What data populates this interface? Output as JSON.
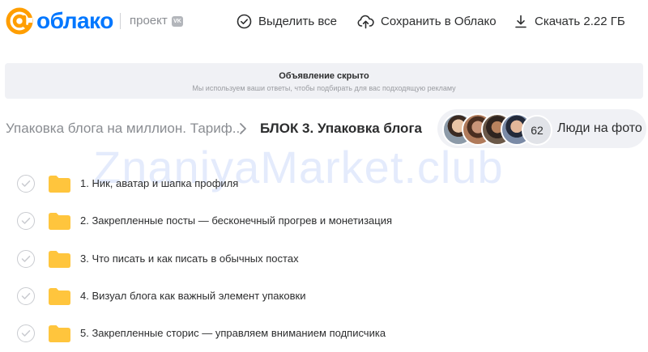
{
  "header": {
    "brand": "облако",
    "project_label": "проект",
    "vk_badge": "VK",
    "actions": {
      "select_all": "Выделить все",
      "save_to_cloud": "Сохранить в Облако",
      "download": "Скачать 2.22 ГБ"
    }
  },
  "ad": {
    "title": "Объявление скрыто",
    "subtitle": "Мы используем ваши ответы, чтобы подбирать для вас подходящую рекламу"
  },
  "breadcrumb": {
    "parent": "Упаковка блога на миллион. Тариф...",
    "current": "БЛОК 3. Упаковка блога"
  },
  "people": {
    "count": "62",
    "label": "Люди на фото"
  },
  "watermark": "ZnaniyaMarket.club",
  "items": [
    {
      "label": "1. Ник, аватар и шапка профиля"
    },
    {
      "label": "2. Закрепленные посты — бесконечный прогрев и монетизация"
    },
    {
      "label": "3. Что писать и как писать в обычных постах"
    },
    {
      "label": "4. Визуал блога как важный элемент упаковки"
    },
    {
      "label": "5. Закрепленные сторис — управляем вниманием подписчика"
    }
  ],
  "colors": {
    "brand_orange": "#ff9e00",
    "brand_blue": "#0077ff",
    "folder_yellow": "#ffc53d"
  }
}
